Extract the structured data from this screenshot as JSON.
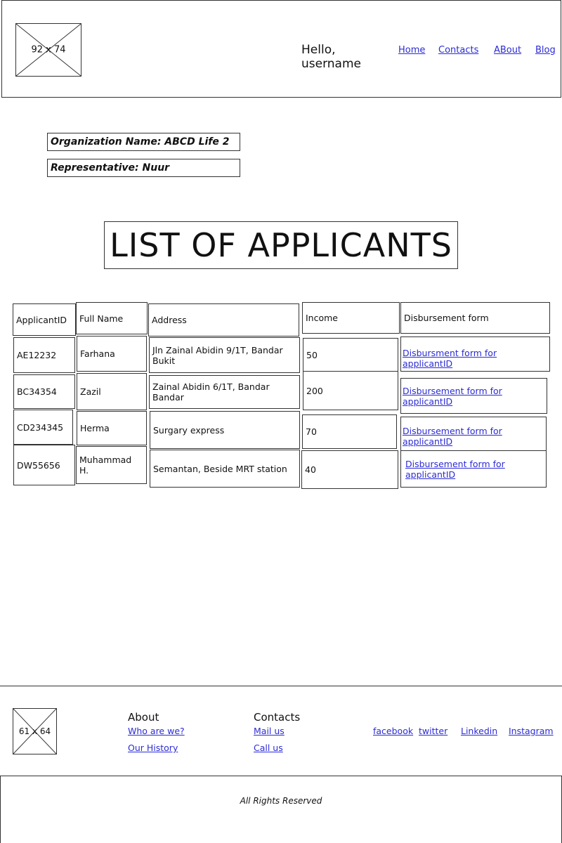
{
  "header": {
    "logo_placeholder": "92 x 74",
    "greeting": "Hello, username",
    "nav": [
      "Home",
      "Contacts",
      "ABout",
      "Blog"
    ]
  },
  "org": {
    "name_line": "Organization Name: ABCD Life 2",
    "rep_line": "Representative: Nuur"
  },
  "page_title": "LIST OF APPLICANTS",
  "table": {
    "headers": [
      "ApplicantID",
      "Full Name",
      "Address",
      "Income",
      "Disbursement form"
    ],
    "rows": [
      {
        "id": "AE12232",
        "name": "Farhana",
        "address": "Jln Zainal Abidin 9/1T, Bandar Bukit",
        "income": "50",
        "link": "Disbursment form for applicantID"
      },
      {
        "id": "BC34354",
        "name": "Zazil",
        "address": "Zainal Abidin 6/1T, Bandar Bandar",
        "income": "200",
        "link": "Disbursement form for applicantID"
      },
      {
        "id": "CD234345",
        "name": "Herma",
        "address": "Surgary express",
        "income": "70",
        "link": "Disbursement form for applicantID"
      },
      {
        "id": "DW55656",
        "name": "Muhammad H.",
        "address": "Semantan, Beside MRT station",
        "income": "40",
        "link": "Disbursement form for applicantID"
      }
    ]
  },
  "footer": {
    "logo_placeholder": "61 x 64",
    "about": {
      "title": "About",
      "links": [
        "Who are we?",
        "Our History"
      ]
    },
    "contacts": {
      "title": "Contacts",
      "links": [
        "Mail us",
        "Call us"
      ]
    },
    "social": [
      "facebook",
      "twitter",
      "Linkedin",
      "Instagram"
    ],
    "copyright": "All Rights Reserved"
  }
}
